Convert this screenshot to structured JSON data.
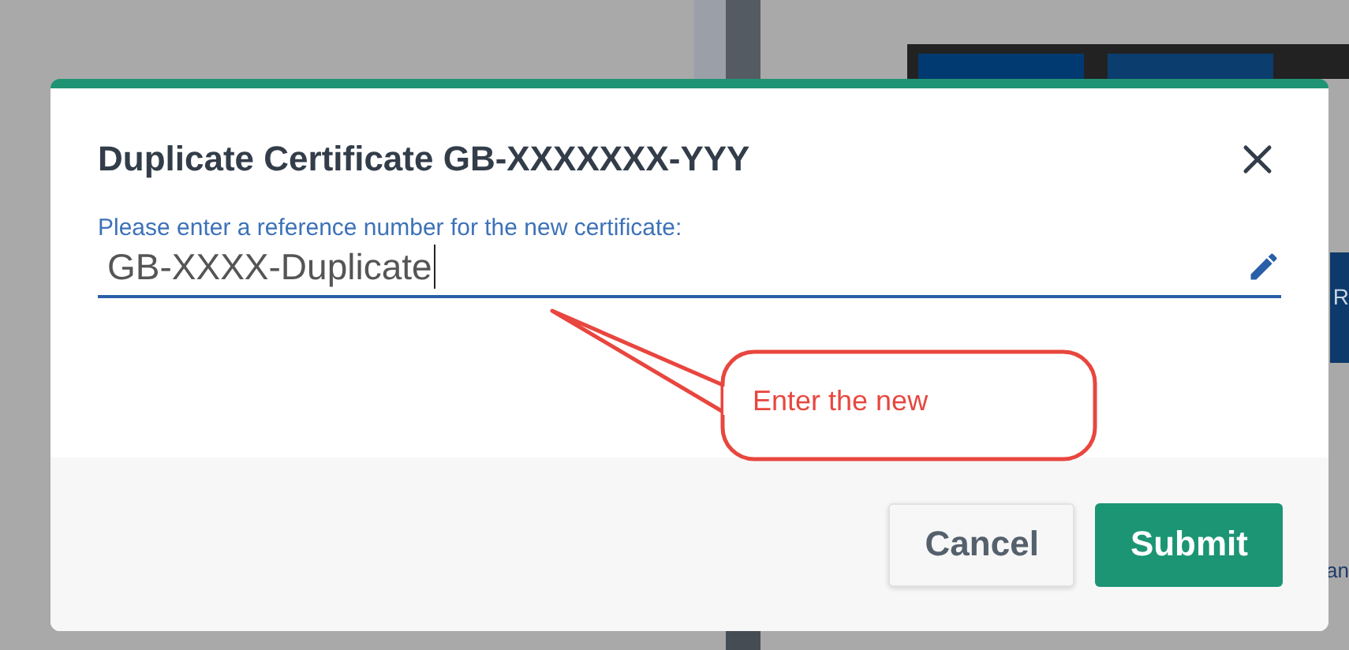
{
  "dialog": {
    "title": "Duplicate Certificate GB-XXXXXXX-YYY",
    "field": {
      "label": "Please enter a reference number for the new certificate:",
      "value": "GB-XXXX-Duplicate",
      "focused": true
    },
    "buttons": [
      {
        "label": "Cancel",
        "kind": "secondary"
      },
      {
        "label": "Submit",
        "kind": "primary"
      }
    ]
  },
  "annotation": {
    "text": "Enter the new"
  },
  "background_fragments": [
    "R",
    "an"
  ]
}
